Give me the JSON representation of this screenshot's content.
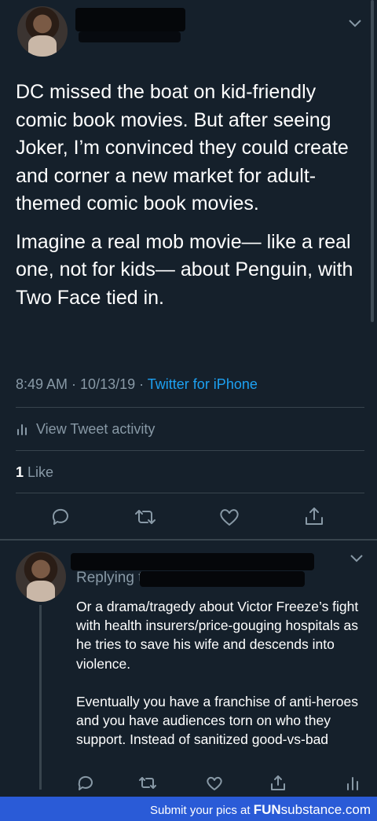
{
  "tweet": {
    "paragraphs": [
      "DC missed the boat on kid-friendly comic book movies. But after seeing Joker, I’m convinced they could create and corner a new market for adult-themed comic book movies.",
      "Imagine a real mob movie— like a real one, not for kids— about Penguin, with Two Face tied in."
    ],
    "time": "8:49 AM",
    "date": "10/13/19",
    "source": "Twitter for iPhone",
    "activity_label": "View Tweet activity",
    "likes_count": "1",
    "likes_label": "Like"
  },
  "reply": {
    "replying_label": "Replying t",
    "paragraphs": [
      "Or a drama/tragedy about Victor Freeze’s fight with health insurers/price-gouging hospitals as he tries to save his wife and descends into violence.",
      "Eventually you have a franchise of anti-heroes and you have audiences torn on who they support. Instead of sanitized good-vs-bad"
    ]
  },
  "footer": {
    "text": "Submit your pics at",
    "brand_fun": "FUN",
    "brand_substance": "substance",
    "brand_tld": ".com"
  },
  "colors": {
    "background": "#15202b",
    "accent": "#1da1f2",
    "secondary_text": "#8899a6",
    "footer_bg": "#2a5bd7"
  },
  "icons": [
    "avatar",
    "chevron-down-icon",
    "activity-bars-icon",
    "reply-icon",
    "retweet-icon",
    "like-icon",
    "share-icon"
  ]
}
